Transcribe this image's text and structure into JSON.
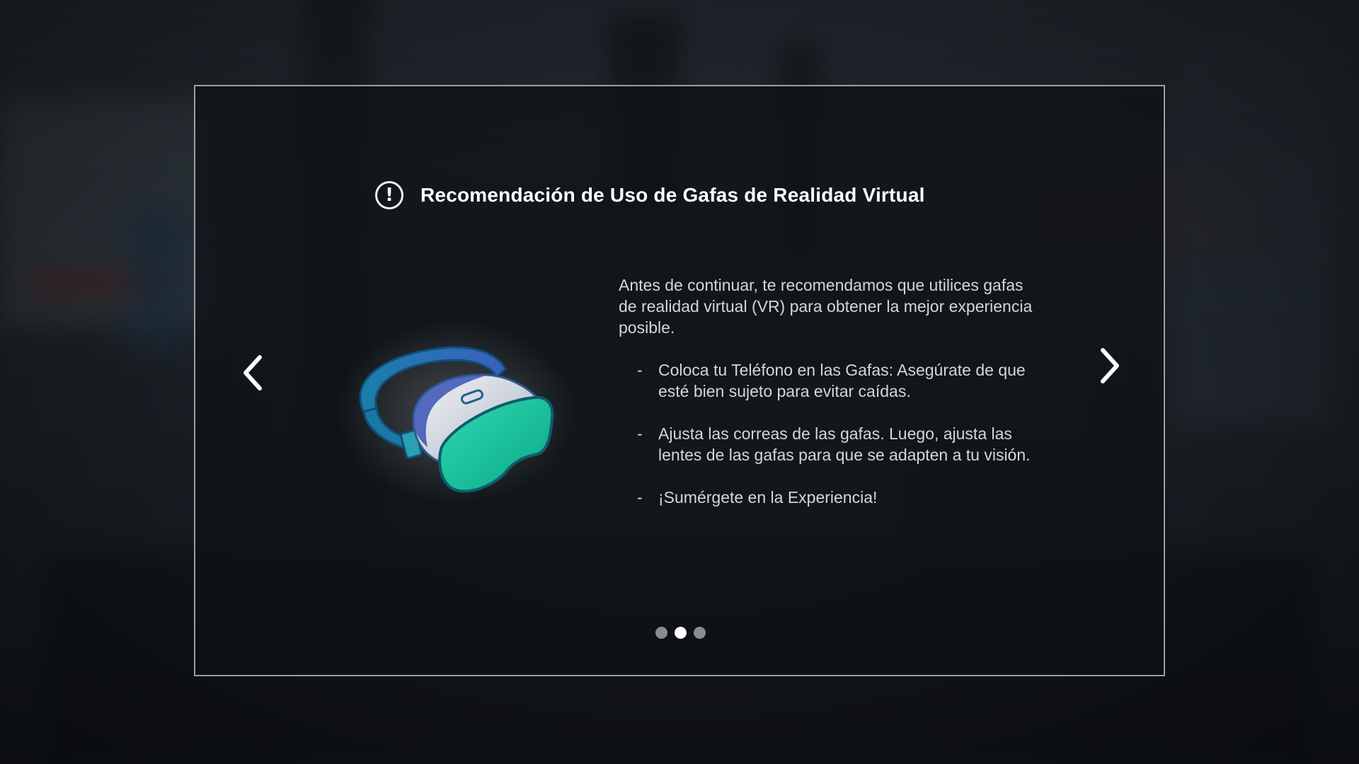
{
  "modal": {
    "icon": "exclamation-circle-icon",
    "title": "Recomendación de Uso de Gafas de Realidad Virtual",
    "intro": "Antes de continuar, te recomendamos que utilices gafas de realidad virtual (VR) para obtener la mejor experiencia posible.",
    "bullets": [
      {
        "dash": "-",
        "text": "Coloca tu Teléfono en las Gafas: Asegúrate de que esté bien sujeto para evitar caídas."
      },
      {
        "dash": "-",
        "text": "Ajusta las correas de las gafas. Luego, ajusta las lentes de las gafas para que se adapten a tu visión."
      },
      {
        "dash": "-",
        "text": "¡Sumérgete en la Experiencia!"
      }
    ],
    "illustration": "vr-headset-illustration",
    "nav": {
      "prev_icon": "chevron-left-icon",
      "next_icon": "chevron-right-icon"
    },
    "pager": {
      "total": 3,
      "active_index": 1
    }
  },
  "colors": {
    "title": "#ffffff",
    "body_text": "#d4d6d8",
    "panel_border": "#c8cdd2",
    "dot_active": "#ffffff",
    "dot_inactive": "#8a8d90",
    "headset_teal": "#1ec9a3",
    "headset_blue": "#1f6fb0"
  }
}
